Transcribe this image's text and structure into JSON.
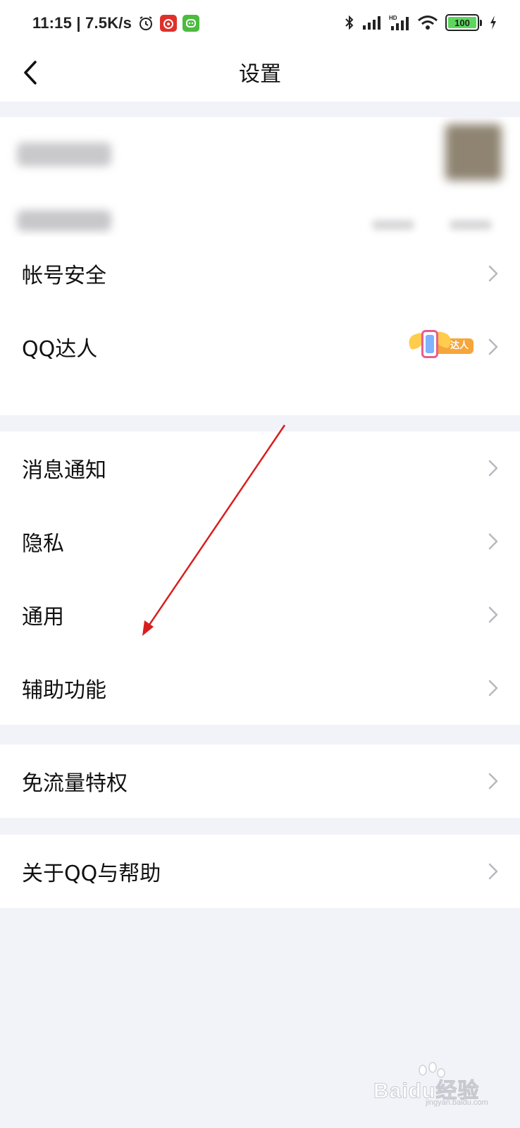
{
  "status_bar": {
    "time_speed": "11:15 | 7.5K/s",
    "battery_level": "100",
    "icons": [
      "alarm-icon",
      "netease-music-icon",
      "app-icon-green",
      "bluetooth-icon",
      "signal-icon",
      "hd-signal-icon",
      "wifi-icon",
      "battery-icon",
      "charging-icon"
    ]
  },
  "header": {
    "title": "设置"
  },
  "groups": {
    "account": {
      "row_account_security": "帐号安全",
      "row_qq_talent": "QQ达人",
      "talent_badge_text": "达人"
    },
    "settings": {
      "row_notifications": "消息通知",
      "row_privacy": "隐私",
      "row_general": "通用",
      "row_accessibility": "辅助功能"
    },
    "data": {
      "row_free_data": "免流量特权"
    },
    "about": {
      "row_about": "关于QQ与帮助"
    }
  },
  "annotation": {
    "color": "#d81e1e",
    "target": "通用"
  },
  "watermark": {
    "text": "Baidu经验",
    "sub": "jingyan.baidu.com"
  },
  "colors": {
    "background": "#f2f3f8",
    "surface": "#ffffff",
    "chevron": "#b8b8bf",
    "text": "#111111"
  }
}
